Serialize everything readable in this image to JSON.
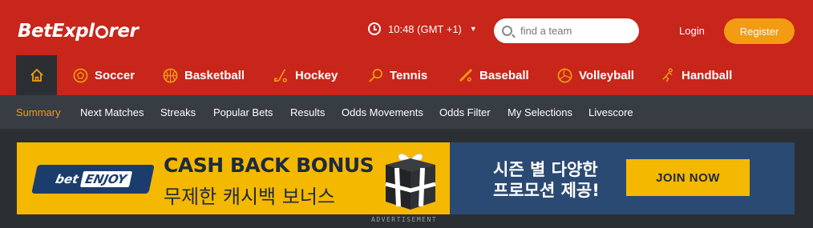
{
  "header": {
    "logo_text_a": "BetExpl",
    "logo_text_b": "rer",
    "time": "10:48 (GMT +1)",
    "search_placeholder": "find a team",
    "login_label": "Login",
    "register_label": "Register"
  },
  "sports": [
    {
      "label": "Soccer",
      "icon": "soccer-ball-icon"
    },
    {
      "label": "Basketball",
      "icon": "basketball-icon"
    },
    {
      "label": "Hockey",
      "icon": "hockey-stick-icon"
    },
    {
      "label": "Tennis",
      "icon": "tennis-racket-icon"
    },
    {
      "label": "Baseball",
      "icon": "baseball-bat-icon"
    },
    {
      "label": "Volleyball",
      "icon": "volleyball-icon"
    },
    {
      "label": "Handball",
      "icon": "handball-player-icon"
    }
  ],
  "subnav": [
    {
      "label": "Summary",
      "active": true
    },
    {
      "label": "Next Matches"
    },
    {
      "label": "Streaks"
    },
    {
      "label": "Popular Bets"
    },
    {
      "label": "Results"
    },
    {
      "label": "Odds Movements"
    },
    {
      "label": "Odds Filter"
    },
    {
      "label": "My Selections"
    },
    {
      "label": "Livescore"
    }
  ],
  "banner": {
    "brand_a": "bet",
    "brand_b": "ENJOY",
    "title": "CASH BACK BONUS",
    "subtitle": "무제한 캐시백 보너스",
    "promo_line1": "시즌 별 다양한",
    "promo_line2": "프로모션 제공!",
    "cta": "JOIN NOW",
    "ad_label": "ADVERTISEMENT"
  },
  "colors": {
    "header_red": "#c8251b",
    "accent_orange": "#f39c12",
    "subnav_bg": "#373d43",
    "banner_yellow": "#f5b800",
    "banner_blue": "#2b4a73"
  }
}
